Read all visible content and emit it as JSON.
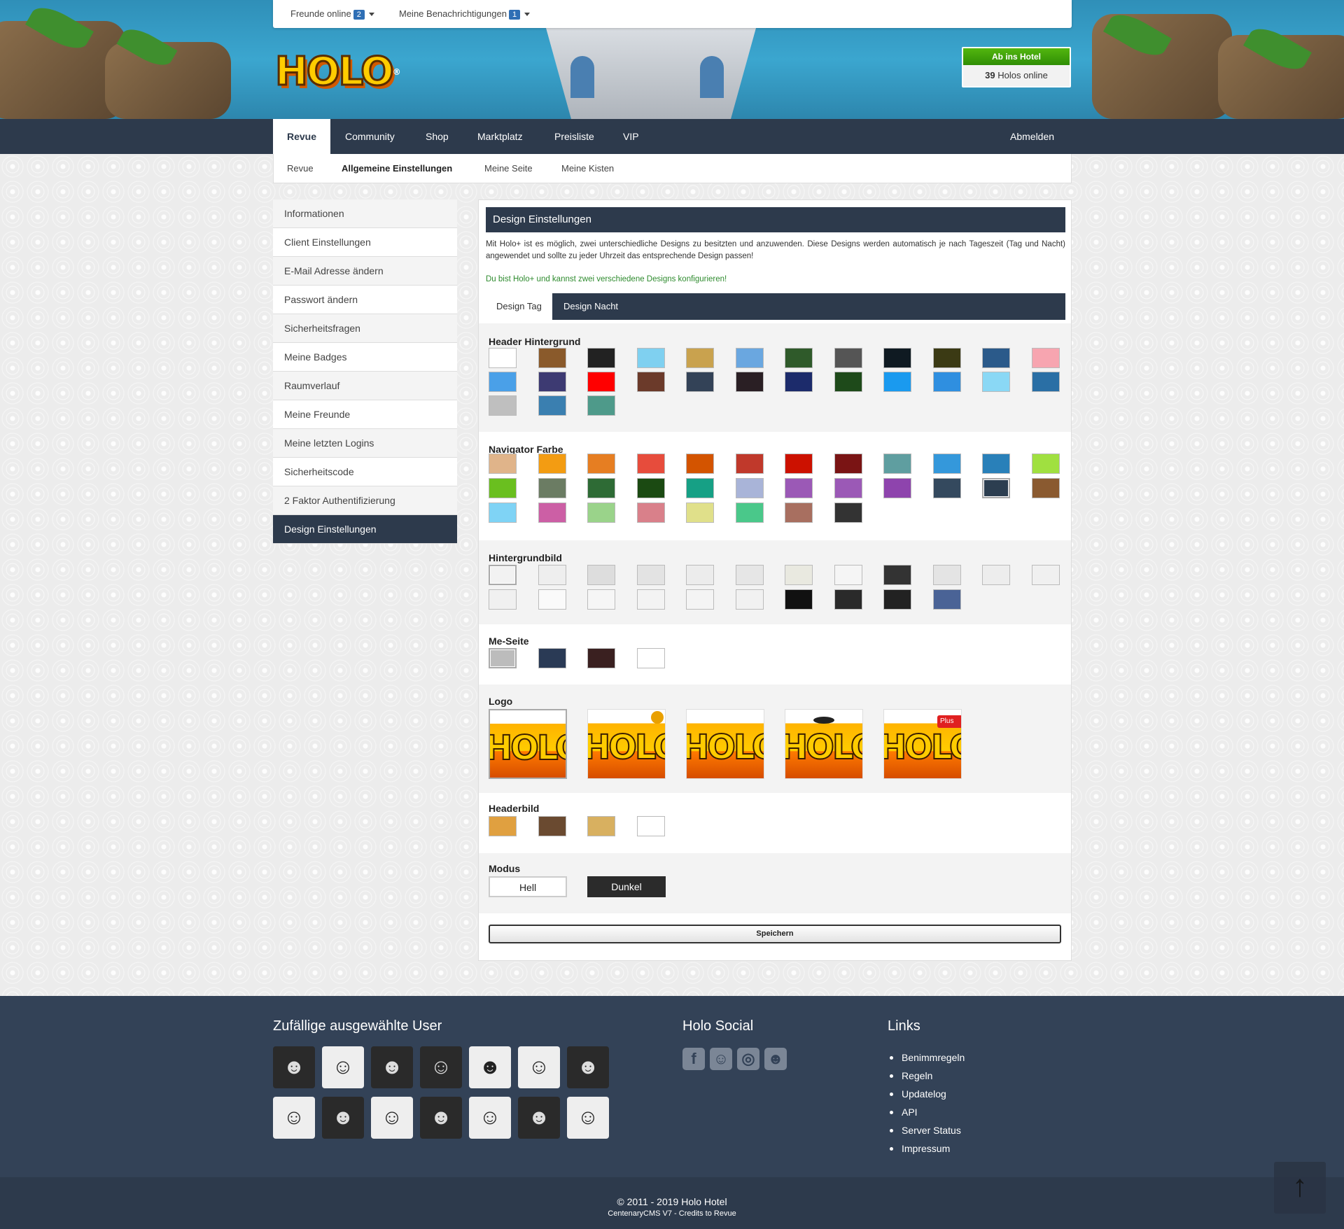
{
  "topbar": {
    "friends_label": "Freunde online",
    "friends_count": "2",
    "notifications_label": "Meine Benachrichtigungen",
    "notifications_count": "1"
  },
  "brand": {
    "logo_text": "HOLO",
    "logo_mark": "®"
  },
  "hotel": {
    "enter_label": "Ab ins Hotel",
    "online_count": "39",
    "online_label": "Holos online"
  },
  "nav": {
    "items": [
      "Revue",
      "Community",
      "Shop",
      "Marktplatz",
      "Preisliste",
      "VIP"
    ],
    "logout": "Abmelden"
  },
  "subnav": {
    "items": [
      "Revue",
      "Allgemeine Einstellungen",
      "Meine Seite",
      "Meine Kisten"
    ]
  },
  "sidebar": {
    "items": [
      "Informationen",
      "Client Einstellungen",
      "E-Mail Adresse ändern",
      "Passwort ändern",
      "Sicherheitsfragen",
      "Meine Badges",
      "Raumverlauf",
      "Meine Freunde",
      "Meine letzten Logins",
      "Sicherheitscode",
      "2 Faktor Authentifizierung",
      "Design Einstellungen"
    ]
  },
  "page": {
    "title": "Design Einstellungen",
    "intro": "Mit Holo+ ist es möglich, zwei unterschiedliche Designs zu besitzten und anzuwenden. Diese Designs werden automatisch je nach Tageszeit (Tag und Nacht) angewendet und sollte zu jeder Uhrzeit das entsprechende Design passen!",
    "note": "Du bist Holo+ und kannst zwei verschiedene Designs konfigurieren!",
    "tabs": [
      "Design Tag",
      "Design Nacht"
    ],
    "sections": {
      "header_bg": "Header Hintergrund",
      "nav_color": "Navigator Farbe",
      "bg_image": "Hintergrundbild",
      "me_page": "Me-Seite",
      "logo": "Logo",
      "header_image": "Headerbild",
      "mode": "Modus"
    },
    "mode": {
      "light": "Hell",
      "dark": "Dunkel"
    },
    "save": "Speichern",
    "logo_option_text": "HOLO",
    "logo_plus_badge": "Plus"
  },
  "colors": {
    "header_bg": [
      "#ffffff",
      "#8a5a2b",
      "#222222",
      "#7fd0f0",
      "#c9a24e",
      "#6aa7e0",
      "#2f5a2a",
      "#555555",
      "#0f1a22",
      "#3b3a14",
      "#2b5a8a",
      "#f7a5b0",
      "#4aa0e8",
      "#3d3a72",
      "#ff0000",
      "#6b3a2a",
      "#334257",
      "#2a1f24",
      "#1c2b6b",
      "#1e4a1a",
      "#1a9aef",
      "#2f8fe0",
      "#8ad8f5",
      "#2a6fa5",
      "#bfbfbf",
      "#3a7fb0",
      "#4e9a8a"
    ],
    "nav_color": [
      "#e0b48a",
      "#f39c12",
      "#e67e22",
      "#e74c3c",
      "#d35400",
      "#c0392b",
      "#cc1100",
      "#7a1414",
      "#5f9ea0",
      "#3498db",
      "#2980b9",
      "#a0e040",
      "#6abf1f",
      "#6b7c63",
      "#2e6b35",
      "#1b4a12",
      "#16a085",
      "#a9b4d8",
      "#9b59b6",
      "#9b59b6",
      "#8e44ad",
      "#34495e",
      "#2c3e50",
      "#8a5a30",
      "#7fd3f5",
      "#cc5fa5",
      "#9ad38a",
      "#d9808a",
      "#e0e08a",
      "#4ac88a",
      "#a86f60",
      "#333333"
    ],
    "bg_image": [
      "#f2f2f2",
      "#eeeeee",
      "#dddddd",
      "#e3e3e3",
      "#ececec",
      "#e6e6e6",
      "#e9e9e0",
      "#f5f5f5",
      "#333333",
      "#e4e4e4",
      "#ededed",
      "#f0f0f0",
      "#f0f0f0",
      "#fafafa",
      "#f6f6f6",
      "#f3f3f3",
      "#f4f4f4",
      "#f1f1f1",
      "#111111",
      "#2a2a2a",
      "#222222",
      "#4a6396"
    ],
    "me_page": [
      "#bcbcbc",
      "#2a3a55",
      "#3a2020",
      "#ffffff"
    ],
    "header_image": [
      "#e0a040",
      "#6a4a30",
      "#d8b060",
      "#ffffff"
    ],
    "accent": "#2d3a4c"
  },
  "footer": {
    "random_users_title": "Zufällige ausgewählte User",
    "social_title": "Holo Social",
    "social_icons": [
      "facebook-icon",
      "snapchat-icon",
      "instagram-icon",
      "discord-icon"
    ],
    "links_title": "Links",
    "links": [
      "Benimmregeln",
      "Regeln",
      "Updatelog",
      "API",
      "Server Status",
      "Impressum"
    ],
    "copyright": "© 2011 - 2019 Holo Hotel",
    "credits": "CentenaryCMS V7 - Credits to Revue"
  }
}
